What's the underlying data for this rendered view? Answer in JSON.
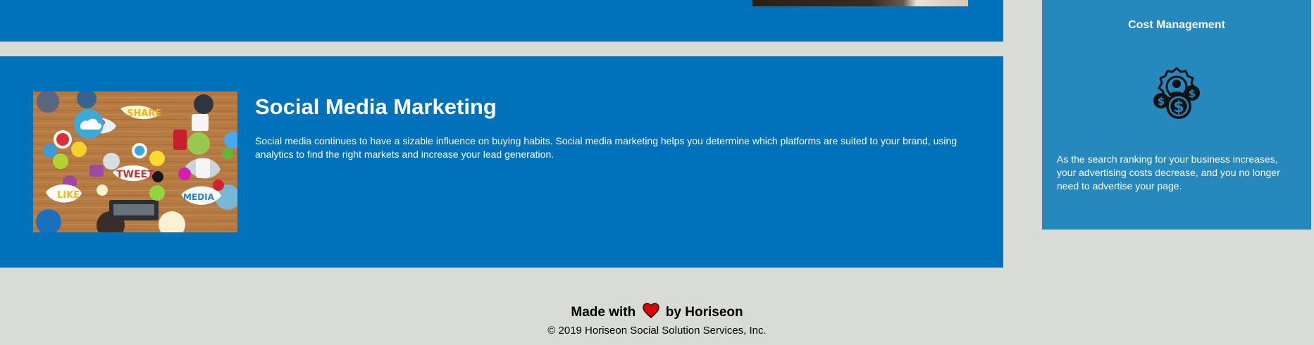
{
  "service": {
    "title": "Social Media Marketing",
    "body": "Social media continues to have a sizable influence on buying habits. Social media marketing helps you determine which platforms are suited to your brand, using analytics to find the right markets and increase your lead generation.",
    "image_words": [
      "SHARE",
      "TWEET",
      "LIKE",
      "MEDIA"
    ]
  },
  "benefit": {
    "title": "Cost Management",
    "icon": "cost-management-icon",
    "body": "As the search ranking for your business increases, your advertising costs decrease, and you no longer need to advertise your page."
  },
  "footer": {
    "made_prefix": "Made with",
    "made_suffix": "by Horiseon",
    "copyright": "© 2019 Horiseon Social Solution Services, Inc.",
    "heart_icon": "heart-icon"
  },
  "colors": {
    "page_bg": "#d9dcd6",
    "panel_blue": "#0072bb",
    "card_blue": "#2589bd",
    "heart_red": "#e10000"
  }
}
